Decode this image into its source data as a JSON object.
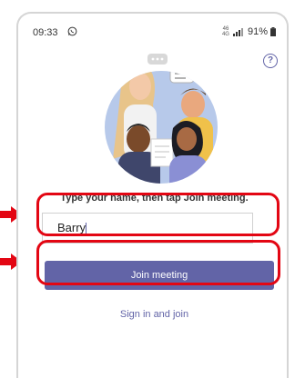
{
  "status": {
    "time": "09:33",
    "battery": "91%",
    "net_top": "46",
    "net_bottom": "4G"
  },
  "prompt": "Type your name, then tap Join meeting.",
  "name_input": {
    "value": "Barry"
  },
  "join_button": {
    "label": "Join meeting"
  },
  "sign_in_link": {
    "label": "Sign in and join"
  },
  "help": {
    "glyph": "?"
  },
  "colors": {
    "accent": "#6264a7",
    "highlight": "#e30613",
    "illustration_bg": "#b7c9ea"
  },
  "icons": [
    "whatsapp-icon",
    "signal-icon",
    "battery-icon",
    "help-icon",
    "people-illustration",
    "highlight-arrow"
  ]
}
